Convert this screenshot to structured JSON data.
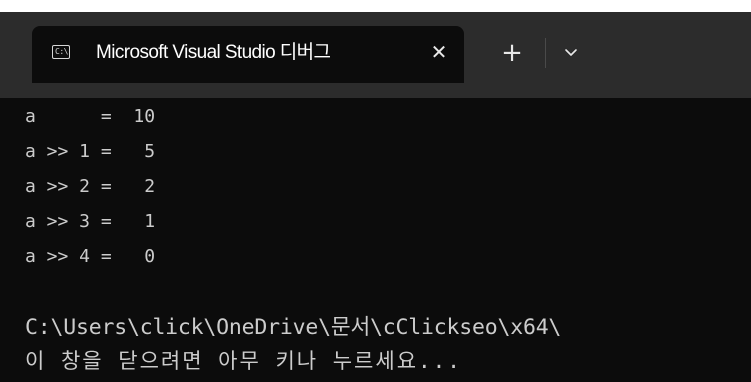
{
  "window": {
    "tab": {
      "icon": "console-icon",
      "icon_glyph": "C:\\",
      "title": "Microsoft Visual Studio 디버그",
      "close_symbol": "✕"
    },
    "new_tab_symbol": "+",
    "dropdown_icon": "chevron-down-icon"
  },
  "terminal": {
    "lines": [
      "a      =  10",
      "a >> 1 =   5",
      "a >> 2 =   2",
      "a >> 3 =   1",
      "a >> 4 =   0"
    ],
    "path_line": "C:\\Users\\click\\OneDrive\\문서\\cClickseo\\x64\\",
    "prompt_line": "이 창을 닫으려면 아무 키나 누르세요..."
  },
  "colors": {
    "titlebar": "#2c2c2c",
    "background": "#0c0c0c",
    "text": "#cccccc"
  }
}
